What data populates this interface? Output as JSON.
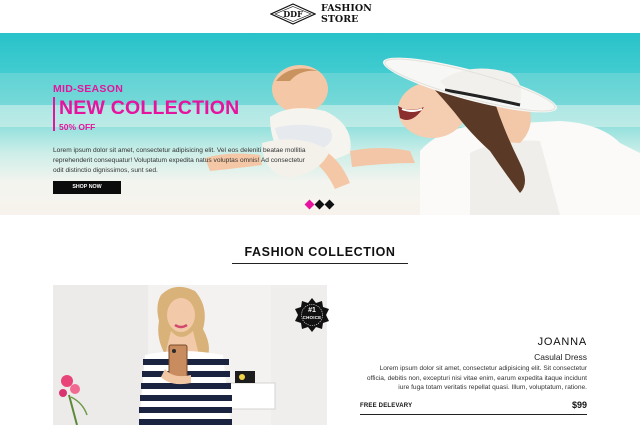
{
  "header": {
    "logo_mark": "DDF",
    "logo_line1": "FASHION",
    "logo_line2": "STORE"
  },
  "hero": {
    "eyebrow": "MID-SEASON",
    "title": "NEW COLLECTION",
    "offer": "50% OFF",
    "body": "Lorem ipsum dolor sit amet, consectetur adipisicing elit. Vel eos deleniti beatae mollitia reprehenderit consequatur! Voluptatum expedita natus voluptas omnis! Ad consectetur odit distinctio dignissimos, sunt sed.",
    "button_label": "SHOP NOW",
    "slides": 3,
    "active_slide": 1
  },
  "collection": {
    "title": "FASHION COLLECTION",
    "badge_top": "#1",
    "badge_bottom": "CHOICE",
    "product": {
      "name": "JOANNA",
      "subtitle": "Casulal Dress",
      "description": "Lorem ipsum dolor sit amet, consectetur adipisicing elit. Sit consectetur officia, debitis non, excepturi nisi vitae enim, earum expedita itaque incidunt iure fuga totam veritatis repellat quasi. Illum, voluptatum, ratione.",
      "shipping": "FREE DELEVARY",
      "price": "$99"
    }
  },
  "colors": {
    "accent": "#e5139d",
    "dark": "#0b0b0b"
  }
}
